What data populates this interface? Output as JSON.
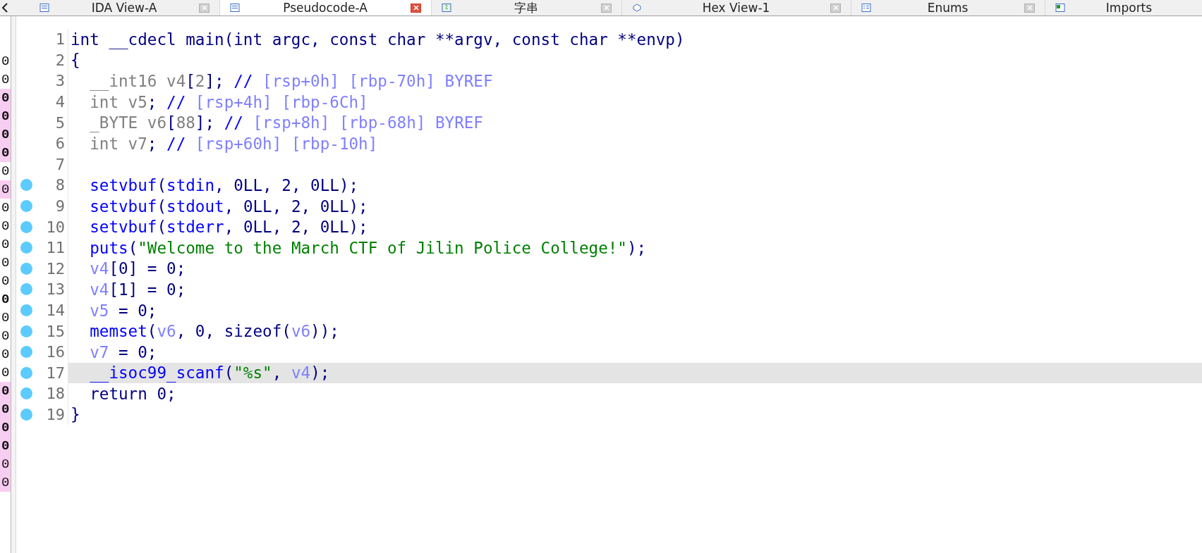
{
  "tabs": [
    {
      "label": "IDA View-A",
      "selected": false
    },
    {
      "label": "Pseudocode-A",
      "selected": true
    },
    {
      "label": "字串",
      "selected": false
    },
    {
      "label": "Hex View-1",
      "selected": false
    },
    {
      "label": "Enums",
      "selected": false
    },
    {
      "label": "Imports",
      "selected": false
    }
  ],
  "side_pane": {
    "rows": [
      {
        "text": "0",
        "bold": false,
        "highlighted": false
      },
      {
        "text": "0",
        "bold": false,
        "highlighted": false
      },
      {
        "text": "0",
        "bold": true,
        "highlighted": true
      },
      {
        "text": "0",
        "bold": true,
        "highlighted": true
      },
      {
        "text": "0",
        "bold": true,
        "highlighted": true
      },
      {
        "text": "0",
        "bold": true,
        "highlighted": true
      },
      {
        "text": "0",
        "bold": false,
        "highlighted": false
      },
      {
        "text": "0",
        "bold": false,
        "highlighted": true
      },
      {
        "text": "0",
        "bold": false,
        "highlighted": false
      },
      {
        "text": "0",
        "bold": false,
        "highlighted": false
      },
      {
        "text": "0",
        "bold": false,
        "highlighted": false
      },
      {
        "text": "0",
        "bold": false,
        "highlighted": false
      },
      {
        "text": "0",
        "bold": false,
        "highlighted": false
      },
      {
        "text": "0",
        "bold": true,
        "highlighted": false
      },
      {
        "text": "0",
        "bold": false,
        "highlighted": false
      },
      {
        "text": "0",
        "bold": false,
        "highlighted": false
      },
      {
        "text": "0",
        "bold": false,
        "highlighted": false
      },
      {
        "text": "0",
        "bold": false,
        "highlighted": false
      },
      {
        "text": "0",
        "bold": true,
        "highlighted": true
      },
      {
        "text": "0",
        "bold": true,
        "highlighted": true
      },
      {
        "text": "0",
        "bold": true,
        "highlighted": true
      },
      {
        "text": "0",
        "bold": true,
        "highlighted": true
      },
      {
        "text": "0",
        "bold": false,
        "highlighted": true
      },
      {
        "text": "0",
        "bold": false,
        "highlighted": true
      }
    ]
  },
  "code": {
    "lines": [
      {
        "number": "1",
        "breakpoint": false,
        "highlighted": false,
        "tokens": [
          {
            "kind": "plain",
            "text": "int __cdecl main(int argc, const char **argv, const char **envp)"
          }
        ]
      },
      {
        "number": "2",
        "breakpoint": false,
        "highlighted": false,
        "tokens": [
          {
            "kind": "plain",
            "text": "{"
          }
        ]
      },
      {
        "number": "3",
        "breakpoint": false,
        "highlighted": false,
        "tokens": [
          {
            "kind": "decl",
            "text": "  __int16 v4"
          },
          {
            "kind": "plain",
            "text": "["
          },
          {
            "kind": "decl",
            "text": "2"
          },
          {
            "kind": "plain",
            "text": "]; "
          },
          {
            "kind": "comment",
            "text": "// "
          },
          {
            "kind": "addr",
            "text": "[rsp+0h] [rbp-70h] BYREF"
          }
        ]
      },
      {
        "number": "4",
        "breakpoint": false,
        "highlighted": false,
        "tokens": [
          {
            "kind": "decl",
            "text": "  int v5"
          },
          {
            "kind": "plain",
            "text": "; "
          },
          {
            "kind": "comment",
            "text": "// "
          },
          {
            "kind": "addr",
            "text": "[rsp+4h] [rbp-6Ch]"
          }
        ]
      },
      {
        "number": "5",
        "breakpoint": false,
        "highlighted": false,
        "tokens": [
          {
            "kind": "decl",
            "text": "  _BYTE v6"
          },
          {
            "kind": "plain",
            "text": "["
          },
          {
            "kind": "decl",
            "text": "88"
          },
          {
            "kind": "plain",
            "text": "]; "
          },
          {
            "kind": "comment",
            "text": "// "
          },
          {
            "kind": "addr",
            "text": "[rsp+8h] [rbp-68h] BYREF"
          }
        ]
      },
      {
        "number": "6",
        "breakpoint": false,
        "highlighted": false,
        "tokens": [
          {
            "kind": "decl",
            "text": "  int v7"
          },
          {
            "kind": "plain",
            "text": "; "
          },
          {
            "kind": "comment",
            "text": "// "
          },
          {
            "kind": "addr",
            "text": "[rsp+60h] [rbp-10h]"
          }
        ]
      },
      {
        "number": "7",
        "breakpoint": false,
        "highlighted": false
      },
      {
        "number": "8",
        "breakpoint": true,
        "highlighted": false,
        "tokens": [
          {
            "kind": "func",
            "text": "  setvbuf"
          },
          {
            "kind": "plain",
            "text": "("
          },
          {
            "kind": "func",
            "text": "stdin"
          },
          {
            "kind": "plain",
            "text": ", 0LL, 2, 0LL);"
          }
        ]
      },
      {
        "number": "9",
        "breakpoint": true,
        "highlighted": false,
        "tokens": [
          {
            "kind": "func",
            "text": "  setvbuf"
          },
          {
            "kind": "plain",
            "text": "("
          },
          {
            "kind": "func",
            "text": "stdout"
          },
          {
            "kind": "plain",
            "text": ", 0LL, 2, 0LL);"
          }
        ]
      },
      {
        "number": "10",
        "breakpoint": true,
        "highlighted": false,
        "tokens": [
          {
            "kind": "func",
            "text": "  setvbuf"
          },
          {
            "kind": "plain",
            "text": "("
          },
          {
            "kind": "func",
            "text": "stderr"
          },
          {
            "kind": "plain",
            "text": ", 0LL, 2, 0LL);"
          }
        ]
      },
      {
        "number": "11",
        "breakpoint": true,
        "highlighted": false,
        "tokens": [
          {
            "kind": "func",
            "text": "  puts"
          },
          {
            "kind": "plain",
            "text": "("
          },
          {
            "kind": "string",
            "text": "\"Welcome to the March CTF of Jilin Police College!\""
          },
          {
            "kind": "plain",
            "text": ");"
          }
        ]
      },
      {
        "number": "12",
        "breakpoint": true,
        "highlighted": false,
        "tokens": [
          {
            "kind": "var",
            "text": "  v4"
          },
          {
            "kind": "plain",
            "text": "[0] = 0;"
          }
        ]
      },
      {
        "number": "13",
        "breakpoint": true,
        "highlighted": false,
        "tokens": [
          {
            "kind": "var",
            "text": "  v4"
          },
          {
            "kind": "plain",
            "text": "[1] = 0;"
          }
        ]
      },
      {
        "number": "14",
        "breakpoint": true,
        "highlighted": false,
        "tokens": [
          {
            "kind": "var",
            "text": "  v5"
          },
          {
            "kind": "plain",
            "text": " = 0;"
          }
        ]
      },
      {
        "number": "15",
        "breakpoint": true,
        "highlighted": false,
        "tokens": [
          {
            "kind": "func",
            "text": "  memset"
          },
          {
            "kind": "plain",
            "text": "("
          },
          {
            "kind": "var",
            "text": "v6"
          },
          {
            "kind": "plain",
            "text": ", 0, sizeof("
          },
          {
            "kind": "var",
            "text": "v6"
          },
          {
            "kind": "plain",
            "text": "));"
          }
        ]
      },
      {
        "number": "16",
        "breakpoint": true,
        "highlighted": false,
        "tokens": [
          {
            "kind": "var",
            "text": "  v7"
          },
          {
            "kind": "plain",
            "text": " = 0;"
          }
        ]
      },
      {
        "number": "17",
        "breakpoint": true,
        "highlighted": true,
        "tokens": [
          {
            "kind": "func",
            "text": "  __isoc99_scanf"
          },
          {
            "kind": "plain",
            "text": "("
          },
          {
            "kind": "string",
            "text": "\"%s\""
          },
          {
            "kind": "plain",
            "text": ", "
          },
          {
            "kind": "var",
            "text": "v4"
          },
          {
            "kind": "plain",
            "text": ");"
          }
        ]
      },
      {
        "number": "18",
        "breakpoint": true,
        "highlighted": false,
        "tokens": [
          {
            "kind": "plain",
            "text": "  return 0;"
          }
        ]
      },
      {
        "number": "19",
        "breakpoint": true,
        "highlighted": false,
        "tokens": [
          {
            "kind": "plain",
            "text": "}"
          }
        ]
      }
    ]
  }
}
